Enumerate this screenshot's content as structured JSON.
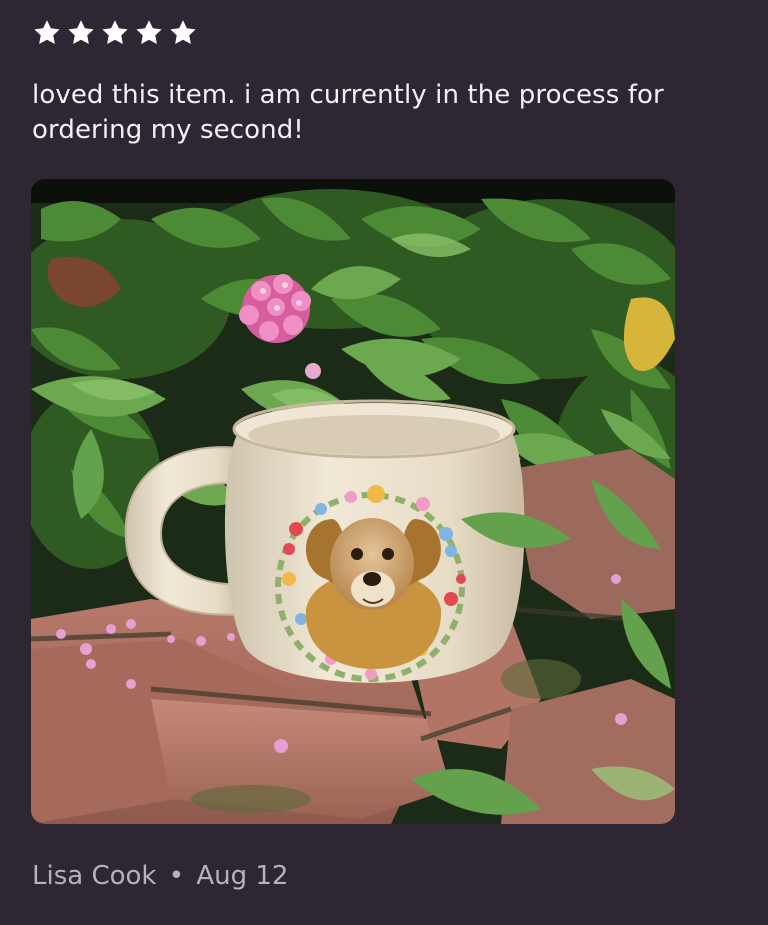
{
  "review": {
    "rating": 5,
    "rating_max": 5,
    "text": "loved this item. i am currently in the process for ordering my second!",
    "author": "Lisa Cook",
    "separator": "•",
    "date": "Aug 12"
  },
  "photo": {
    "subject": "ceramic mug with painted dog portrait and floral wreath among green leaves and pink flowers on brick"
  },
  "colors": {
    "background": "#2e2733",
    "text_primary": "#f3f1f5",
    "text_secondary": "#b7b1bb",
    "star": "#ffffff"
  }
}
